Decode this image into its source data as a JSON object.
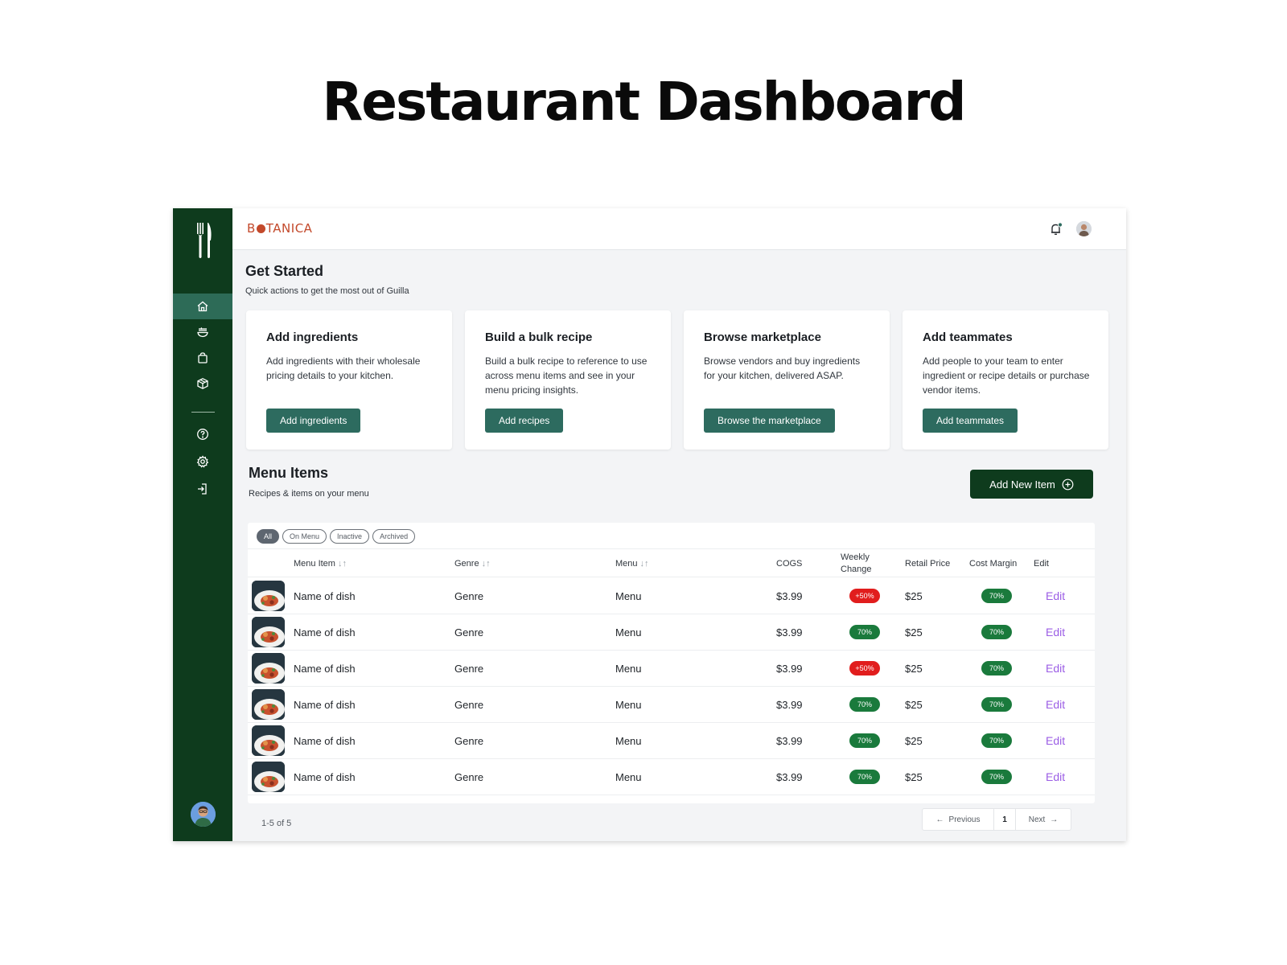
{
  "page": {
    "heading": "Restaurant Dashboard"
  },
  "header": {
    "brand": {
      "pre": "B",
      "post": "TANICA"
    }
  },
  "get_started": {
    "title": "Get Started",
    "subtitle": "Quick actions to get the most out of Guilla",
    "cards": [
      {
        "title": "Add ingredients",
        "desc": "Add ingredients with their wholesale pricing details to your kitchen.",
        "button": "Add ingredients"
      },
      {
        "title": "Build a bulk recipe",
        "desc": "Build a bulk recipe to reference to use across menu items and see in your menu pricing insights.",
        "button": "Add recipes"
      },
      {
        "title": "Browse marketplace",
        "desc": "Browse vendors and buy ingredients for your kitchen, delivered ASAP.",
        "button": "Browse the marketplace"
      },
      {
        "title": "Add teammates",
        "desc": "Add people to your team to enter ingredient or recipe details or purchase vendor items.",
        "button": "Add teammates"
      }
    ]
  },
  "menu_items": {
    "title": "Menu Items",
    "subtitle": "Recipes & items on your menu",
    "add_button": "Add New Item",
    "filters": [
      "All",
      "On Menu",
      "Inactive",
      "Archived"
    ],
    "columns": [
      "Menu Item",
      "Genre",
      "Menu",
      "COGS",
      "Weekly Change",
      "Retail Price",
      "Cost Margin",
      "Edit"
    ],
    "rows": [
      {
        "name": "Name of dish",
        "genre": "Genre",
        "menu": "Menu",
        "cogs": "$3.99",
        "weekly": "+50%",
        "weekly_status": "red",
        "retail": "$25",
        "margin": "70%",
        "edit": "Edit"
      },
      {
        "name": "Name of dish",
        "genre": "Genre",
        "menu": "Menu",
        "cogs": "$3.99",
        "weekly": "70%",
        "weekly_status": "green",
        "retail": "$25",
        "margin": "70%",
        "edit": "Edit"
      },
      {
        "name": "Name of dish",
        "genre": "Genre",
        "menu": "Menu",
        "cogs": "$3.99",
        "weekly": "+50%",
        "weekly_status": "red",
        "retail": "$25",
        "margin": "70%",
        "edit": "Edit"
      },
      {
        "name": "Name of dish",
        "genre": "Genre",
        "menu": "Menu",
        "cogs": "$3.99",
        "weekly": "70%",
        "weekly_status": "green",
        "retail": "$25",
        "margin": "70%",
        "edit": "Edit"
      },
      {
        "name": "Name of dish",
        "genre": "Genre",
        "menu": "Menu",
        "cogs": "$3.99",
        "weekly": "70%",
        "weekly_status": "green",
        "retail": "$25",
        "margin": "70%",
        "edit": "Edit"
      },
      {
        "name": "Name of dish",
        "genre": "Genre",
        "menu": "Menu",
        "cogs": "$3.99",
        "weekly": "70%",
        "weekly_status": "green",
        "retail": "$25",
        "margin": "70%",
        "edit": "Edit"
      }
    ]
  },
  "pagination": {
    "range": "1-5 of 5",
    "previous": "Previous",
    "page": "1",
    "next": "Next"
  },
  "colors": {
    "sidebar": "#0e3b1d",
    "accent_button": "#2d6b5f",
    "brand": "#c3492b",
    "negative": "#e11d1d",
    "positive": "#1a7a3c",
    "edit_link": "#9b5de5"
  },
  "icons": {
    "sidebar": [
      "home-icon",
      "bowl-icon",
      "shopping-bag-icon",
      "box-icon",
      "help-icon",
      "settings-icon",
      "logout-icon"
    ],
    "header": [
      "bell-icon",
      "user-avatar"
    ]
  }
}
